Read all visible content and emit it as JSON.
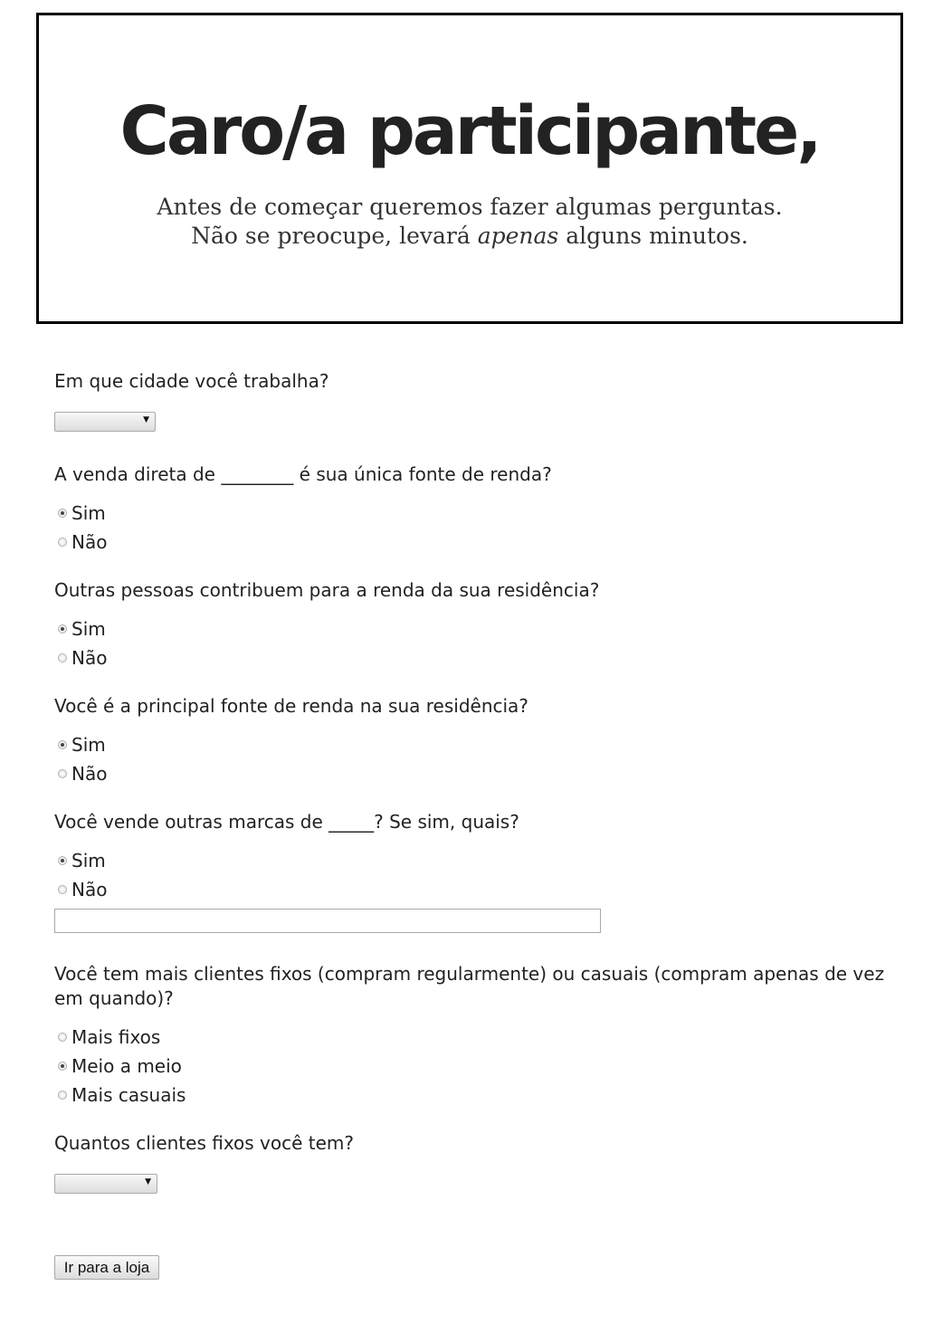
{
  "header": {
    "title": "Caro/a participante,",
    "subtitle_line1": "Antes de começar queremos fazer algumas perguntas.",
    "subtitle_line2_before": "Não se preocupe, levará ",
    "subtitle_line2_emphasis": "apenas",
    "subtitle_line2_after": " alguns minutos."
  },
  "questions": {
    "city": {
      "label": "Em que cidade você trabalha?",
      "selected": ""
    },
    "only_income": {
      "label": "A venda direta de ________ é sua única fonte de renda?",
      "options": [
        "Sim",
        "Não"
      ],
      "selected": "Sim"
    },
    "others_contribute": {
      "label": "Outras pessoas contribuem para a renda da sua residência?",
      "options": [
        "Sim",
        "Não"
      ],
      "selected": "Sim"
    },
    "main_source": {
      "label": "Você é a principal fonte de renda na sua residência?",
      "options": [
        "Sim",
        "Não"
      ],
      "selected": "Sim"
    },
    "other_brands": {
      "label": "Você vende outras marcas de _____? Se sim, quais?",
      "options": [
        "Sim",
        "Não"
      ],
      "selected": "Sim",
      "text_value": ""
    },
    "client_type": {
      "label": "Você tem mais clientes fixos (compram regularmente) ou casuais (compram apenas de vez em quando)?",
      "options": [
        "Mais fixos",
        "Meio a meio",
        "Mais casuais"
      ],
      "selected": "Meio a meio"
    },
    "fixed_clients": {
      "label": "Quantos clientes fixos você tem?",
      "selected": ""
    }
  },
  "submit": {
    "label": "Ir para a loja"
  },
  "icons": {
    "dropdown": "chevron-down-icon"
  }
}
